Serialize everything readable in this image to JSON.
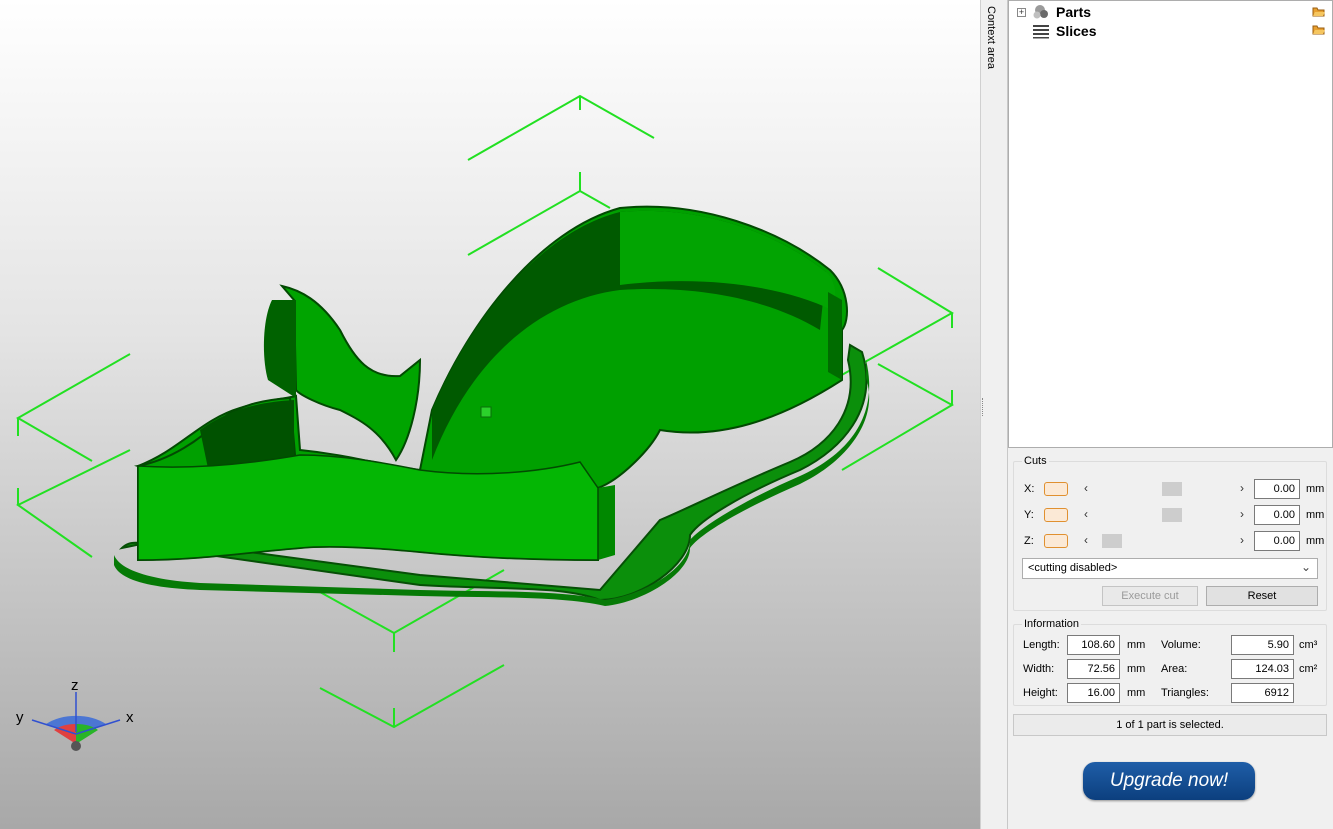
{
  "context_area_label": "Context area",
  "tree": {
    "items": [
      {
        "label": "Parts",
        "icon": "parts-icon",
        "expandable": true
      },
      {
        "label": "Slices",
        "icon": "slices-icon",
        "expandable": false
      }
    ]
  },
  "cuts": {
    "title": "Cuts",
    "axes": [
      {
        "label": "X:",
        "value": "0.00",
        "unit": "mm",
        "slider_position": 0.5
      },
      {
        "label": "Y:",
        "value": "0.00",
        "unit": "mm",
        "slider_position": 0.5
      },
      {
        "label": "Z:",
        "value": "0.00",
        "unit": "mm",
        "slider_position": 0.0
      }
    ],
    "mode_select": "<cutting disabled>",
    "execute_label": "Execute cut",
    "reset_label": "Reset"
  },
  "information": {
    "title": "Information",
    "length_label": "Length:",
    "length_value": "108.60",
    "length_unit": "mm",
    "width_label": "Width:",
    "width_value": "72.56",
    "width_unit": "mm",
    "height_label": "Height:",
    "height_value": "16.00",
    "height_unit": "mm",
    "volume_label": "Volume:",
    "volume_value": "5.90",
    "volume_unit": "cm³",
    "area_label": "Area:",
    "area_value": "124.03",
    "area_unit": "cm²",
    "triangles_label": "Triangles:",
    "triangles_value": "6912"
  },
  "status": "1 of 1 part is selected.",
  "upgrade_label": "Upgrade now!",
  "axis_gizmo": {
    "x": "x",
    "y": "y",
    "z": "z"
  },
  "colors": {
    "model": "#0aa80a",
    "bbox": "#22e022",
    "upgrade": "#0f4a8e",
    "toggle": "#e09030"
  }
}
